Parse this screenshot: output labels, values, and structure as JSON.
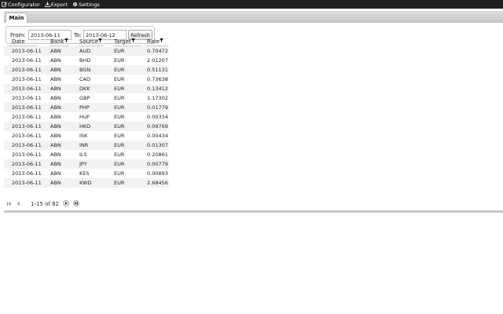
{
  "toolbar": {
    "configurator_label": "Configurator",
    "export_label": "Export",
    "settings_label": "Settings"
  },
  "tabs": [
    {
      "label": "Main"
    }
  ],
  "filter": {
    "from_label": "From:",
    "from_value": "2013-06-11",
    "to_label": "To:",
    "to_value": "2013-06-12",
    "refresh_label": "Refresh"
  },
  "grid": {
    "columns": [
      "Date",
      "Bank",
      "Source",
      "Target",
      "Rate"
    ],
    "rows": [
      [
        "2013-06-11",
        "ABN",
        "AUD",
        "EUR",
        "0.70472"
      ],
      [
        "2013-06-11",
        "ABN",
        "BHD",
        "EUR",
        "2.01207"
      ],
      [
        "2013-06-11",
        "ABN",
        "BGN",
        "EUR",
        "0.51131"
      ],
      [
        "2013-06-11",
        "ABN",
        "CAD",
        "EUR",
        "0.73638"
      ],
      [
        "2013-06-11",
        "ABN",
        "DKK",
        "EUR",
        "0.13412"
      ],
      [
        "2013-06-11",
        "ABN",
        "GBP",
        "EUR",
        "1.17302"
      ],
      [
        "2013-06-11",
        "ABN",
        "PHP",
        "EUR",
        "0.01779"
      ],
      [
        "2013-06-11",
        "ABN",
        "HUF",
        "EUR",
        "0.00334"
      ],
      [
        "2013-06-11",
        "ABN",
        "HKD",
        "EUR",
        "0.09769"
      ],
      [
        "2013-06-11",
        "ABN",
        "ISK",
        "EUR",
        "0.00434"
      ],
      [
        "2013-06-11",
        "ABN",
        "INR",
        "EUR",
        "0.01307"
      ],
      [
        "2013-06-11",
        "ABN",
        "ILS",
        "EUR",
        "0.20861"
      ],
      [
        "2013-06-11",
        "ABN",
        "JPY",
        "EUR",
        "0.00779"
      ],
      [
        "2013-06-11",
        "ABN",
        "KES",
        "EUR",
        "0.00893"
      ],
      [
        "2013-06-11",
        "ABN",
        "KWD",
        "EUR",
        "2.68456"
      ]
    ]
  },
  "pager": {
    "info": "1-15 of 82"
  },
  "icons": {
    "configurator": "pencil-icon",
    "export": "download-icon",
    "settings": "gear-icon",
    "filter": "funnel-icon",
    "first": "first-page-icon",
    "prev": "prev-page-icon",
    "next": "next-page-icon",
    "last": "last-page-icon"
  }
}
